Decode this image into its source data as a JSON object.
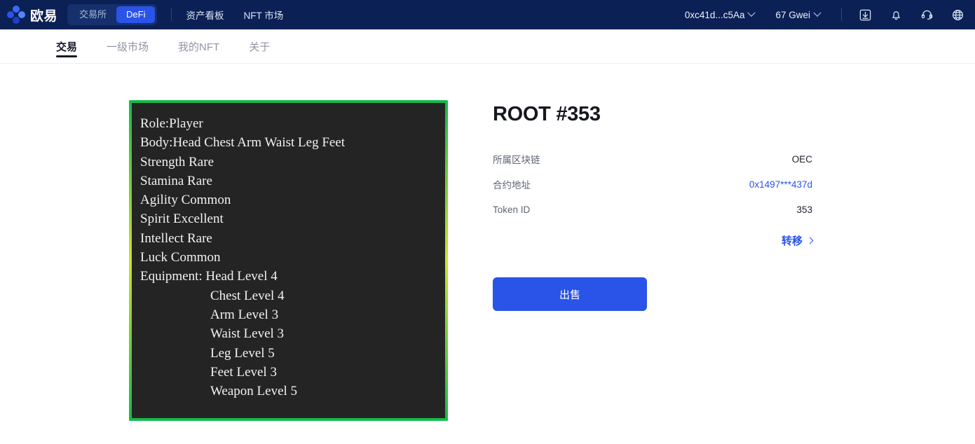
{
  "header": {
    "brand_name": "欧易",
    "logo_icon": "okx-dots-logo-icon",
    "segments": [
      {
        "label": "交易所",
        "active": false
      },
      {
        "label": "DeFi",
        "active": true
      }
    ],
    "links": [
      {
        "label": "资产看板"
      },
      {
        "label": "NFT 市场"
      }
    ],
    "wallet": "0xc41d...c5Aa",
    "gas": "67 Gwei",
    "icons": [
      {
        "name": "download-icon"
      },
      {
        "name": "bell-icon"
      },
      {
        "name": "headset-icon"
      },
      {
        "name": "globe-icon"
      }
    ]
  },
  "nav": {
    "tabs": [
      {
        "label": "交易",
        "active": true
      },
      {
        "label": "一级市场",
        "active": false
      },
      {
        "label": "我的NFT",
        "active": false
      },
      {
        "label": "关于",
        "active": false
      }
    ]
  },
  "nft_card": {
    "border_gradient_from": "#15b94b",
    "border_gradient_to": "#d8e52a",
    "background": "#232423",
    "lines": [
      {
        "text": "Role:Player",
        "indent": false
      },
      {
        "text": "Body:Head Chest Arm Waist Leg Feet",
        "indent": false
      },
      {
        "text": "Strength Rare",
        "indent": false
      },
      {
        "text": "Stamina Rare",
        "indent": false
      },
      {
        "text": "Agility Common",
        "indent": false
      },
      {
        "text": "Spirit Excellent",
        "indent": false
      },
      {
        "text": "Intellect Rare",
        "indent": false
      },
      {
        "text": "Luck Common",
        "indent": false
      },
      {
        "text": "Equipment: Head Level 4",
        "indent": false
      },
      {
        "text": "Chest Level 4",
        "indent": true
      },
      {
        "text": "Arm Level 3",
        "indent": true
      },
      {
        "text": "Waist Level 3",
        "indent": true
      },
      {
        "text": "Leg Level 5",
        "indent": true
      },
      {
        "text": "Feet Level 3",
        "indent": true
      },
      {
        "text": "Weapon Level 5",
        "indent": true
      }
    ]
  },
  "detail": {
    "title": "ROOT #353",
    "rows": [
      {
        "label": "所属区块链",
        "value": "OEC",
        "link": false
      },
      {
        "label": "合约地址",
        "value": "0x1497***437d",
        "link": true
      },
      {
        "label": "Token ID",
        "value": "353",
        "link": false
      }
    ],
    "transfer_label": "转移",
    "sell_label": "出售",
    "accent_color": "#2a53e8"
  }
}
